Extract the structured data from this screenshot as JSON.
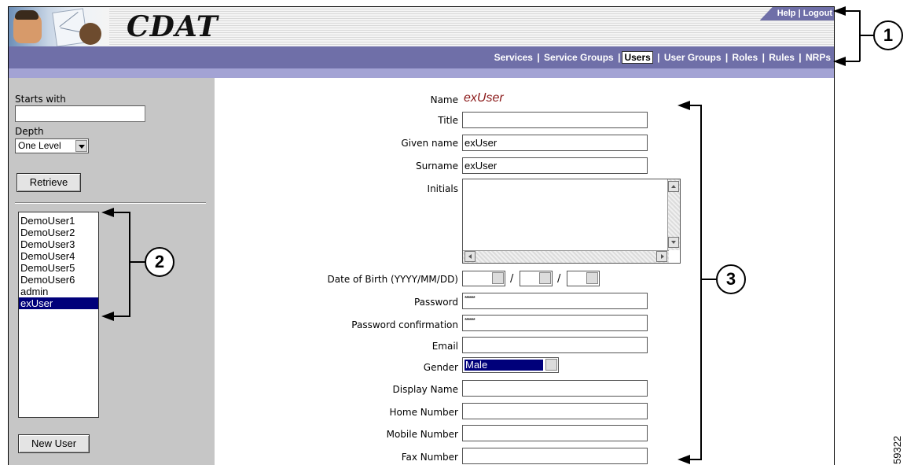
{
  "header": {
    "app_title": "CDAT",
    "util_links": [
      "Help",
      "Logout"
    ],
    "nav_links": [
      "Services",
      "Service Groups",
      "Users",
      "User Groups",
      "Roles",
      "Rules",
      "NRPs"
    ],
    "active_nav": "Users"
  },
  "sidebar": {
    "starts_with_label": "Starts with",
    "starts_with_value": "",
    "depth_label": "Depth",
    "depth_value": "One Level",
    "retrieve_label": "Retrieve",
    "users": [
      "DemoUser1",
      "DemoUser2",
      "DemoUser3",
      "DemoUser4",
      "DemoUser5",
      "DemoUser6",
      "admin",
      "exUser"
    ],
    "selected_user": "exUser",
    "new_user_label": "New User"
  },
  "form": {
    "name_label": "Name",
    "name_value": "exUser",
    "title_label": "Title",
    "title_value": "",
    "given_name_label": "Given name",
    "given_name_value": "exUser",
    "surname_label": "Surname",
    "surname_value": "exUser",
    "initials_label": "Initials",
    "initials_value": "",
    "dob_label": "Date of Birth (YYYY/MM/DD)",
    "dob_separator": "/",
    "password_label": "Password",
    "password_value": "******",
    "password_confirm_label": "Password confirmation",
    "password_confirm_value": "******",
    "email_label": "Email",
    "email_value": "",
    "gender_label": "Gender",
    "gender_value": "Male",
    "display_name_label": "Display Name",
    "display_name_value": "",
    "home_number_label": "Home Number",
    "home_number_value": "",
    "mobile_number_label": "Mobile Number",
    "mobile_number_value": "",
    "fax_number_label": "Fax Number",
    "fax_number_value": ""
  },
  "callouts": [
    "1",
    "2",
    "3"
  ],
  "figure_id": "59322",
  "colors": {
    "nav_bar": "#6f6fa8",
    "sub_bar": "#a3a3d4",
    "left_panel": "#c6c6c6",
    "selection": "#00007a",
    "name_value": "#8b1a1a"
  },
  "icons": [
    "logo-illustration",
    "dropdown-arrow-icon",
    "scroll-up-icon",
    "scroll-down-icon",
    "scroll-left-icon",
    "scroll-right-icon",
    "arrow-left-icon"
  ]
}
